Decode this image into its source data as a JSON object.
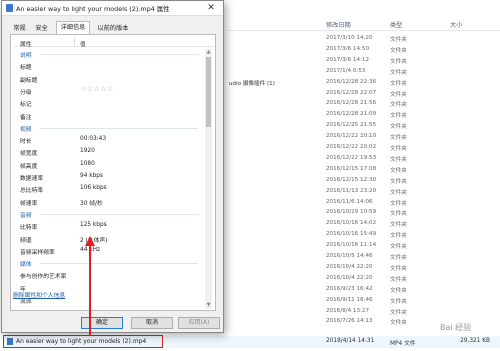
{
  "explorer": {
    "header": {
      "date": "修改日期",
      "type": "类型",
      "size": "大小"
    },
    "rows": [
      {
        "date": "2017/3/10 14:20",
        "type": "文件夹",
        "name": "",
        "size": ""
      },
      {
        "date": "2017/3/6 14:50",
        "type": "文件夹",
        "name": "",
        "size": ""
      },
      {
        "date": "2017/3/6 14:12",
        "type": "文件夹",
        "name": "",
        "size": ""
      },
      {
        "date": "2017/1/4 0:53",
        "type": "文件夹",
        "name": "",
        "size": ""
      },
      {
        "date": "2016/12/28 22:36",
        "type": "文件夹",
        "name": "udio 摄像插件 (1)",
        "size": ""
      },
      {
        "date": "2016/12/28 22:07",
        "type": "文件夹",
        "name": "",
        "size": ""
      },
      {
        "date": "2016/12/28 21:56",
        "type": "文件夹",
        "name": "",
        "size": ""
      },
      {
        "date": "2016/12/28 21:09",
        "type": "文件夹",
        "name": "",
        "size": ""
      },
      {
        "date": "2016/12/25 21:55",
        "type": "文件夹",
        "name": "",
        "size": ""
      },
      {
        "date": "2016/12/22 20:10",
        "type": "文件夹",
        "name": "",
        "size": ""
      },
      {
        "date": "2016/12/22 20:02",
        "type": "文件夹",
        "name": "",
        "size": ""
      },
      {
        "date": "2016/12/22 19:53",
        "type": "文件夹",
        "name": "",
        "size": ""
      },
      {
        "date": "2016/12/15 17:08",
        "type": "文件夹",
        "name": "",
        "size": ""
      },
      {
        "date": "2016/12/15 12:30",
        "type": "文件夹",
        "name": "",
        "size": ""
      },
      {
        "date": "2016/11/13 23:20",
        "type": "文件夹",
        "name": "",
        "size": ""
      },
      {
        "date": "2016/11/6 14:06",
        "type": "文件夹",
        "name": "",
        "size": ""
      },
      {
        "date": "2016/10/29 10:59",
        "type": "文件夹",
        "name": "",
        "size": ""
      },
      {
        "date": "2016/10/16 14:02",
        "type": "文件夹",
        "name": "",
        "size": ""
      },
      {
        "date": "2016/10/16 15:49",
        "type": "文件夹",
        "name": "",
        "size": ""
      },
      {
        "date": "2016/10/16 11:14",
        "type": "文件夹",
        "name": "",
        "size": ""
      },
      {
        "date": "2016/10/5 14:46",
        "type": "文件夹",
        "name": "",
        "size": ""
      },
      {
        "date": "2016/10/4 22:20",
        "type": "文件夹",
        "name": "",
        "size": ""
      },
      {
        "date": "2016/10/4 22:20",
        "type": "文件夹",
        "name": "",
        "size": ""
      },
      {
        "date": "2016/9/23 16:42",
        "type": "文件夹",
        "name": "",
        "size": ""
      },
      {
        "date": "2016/9/11 18:46",
        "type": "文件夹",
        "name": "",
        "size": ""
      },
      {
        "date": "2016/8/4 13:27",
        "type": "文件夹",
        "name": "",
        "size": ""
      },
      {
        "date": "2016/7/26 14:13",
        "type": "文件夹",
        "name": "",
        "size": ""
      }
    ],
    "selected": {
      "name": "An easier way to light your models (2).mp4",
      "date": "2018/4/14 14:31",
      "type": "MP4 文件",
      "size": "29,321 KB"
    },
    "watermark": "Bai 经验"
  },
  "dialog": {
    "title": "An easier way to light your models (2).mp4 属性",
    "tabs": [
      "常规",
      "安全",
      "详细信息",
      "以前的版本"
    ],
    "active_tab": "详细信息",
    "columns": {
      "property": "属性",
      "value": "值"
    },
    "rows": [
      {
        "kind": "section",
        "k": "说明",
        "v": ""
      },
      {
        "kind": "item",
        "k": "标题",
        "v": ""
      },
      {
        "kind": "item",
        "k": "副标题",
        "v": ""
      },
      {
        "kind": "rating",
        "k": "分级",
        "v": "☆☆☆☆☆"
      },
      {
        "kind": "item",
        "k": "标记",
        "v": ""
      },
      {
        "kind": "item",
        "k": "备注",
        "v": ""
      },
      {
        "kind": "section",
        "k": "视频",
        "v": ""
      },
      {
        "kind": "item",
        "k": "时长",
        "v": "00:03:43"
      },
      {
        "kind": "item",
        "k": "帧宽度",
        "v": "1920"
      },
      {
        "kind": "item",
        "k": "帧高度",
        "v": "1080"
      },
      {
        "kind": "item",
        "k": "数据速率",
        "v": "94 kbps"
      },
      {
        "kind": "item",
        "k": "总比特率",
        "v": "106 kbps"
      },
      {
        "kind": "item",
        "k": "帧速率",
        "v": "30 帧/秒"
      },
      {
        "kind": "section",
        "k": "音频",
        "v": ""
      },
      {
        "kind": "item",
        "k": "比特率",
        "v": "125 kbps"
      },
      {
        "kind": "item",
        "k": "频道",
        "v": "2 (立体声)"
      },
      {
        "kind": "item",
        "k": "音频采样频率",
        "v": "44 kHz"
      },
      {
        "kind": "section",
        "k": "媒体",
        "v": ""
      },
      {
        "kind": "item",
        "k": "参与创作的艺术家",
        "v": ""
      },
      {
        "kind": "item",
        "k": "年",
        "v": ""
      },
      {
        "kind": "item",
        "k": "流派",
        "v": ""
      }
    ],
    "remove_link": "删除属性和个人信息",
    "buttons": {
      "ok": "确定",
      "cancel": "取消",
      "apply": "应用(A)"
    },
    "close_glyph": "✕"
  },
  "colors": {
    "annotation": "#e02020",
    "link": "#1e5fa8",
    "selection": "#eef5fc"
  }
}
